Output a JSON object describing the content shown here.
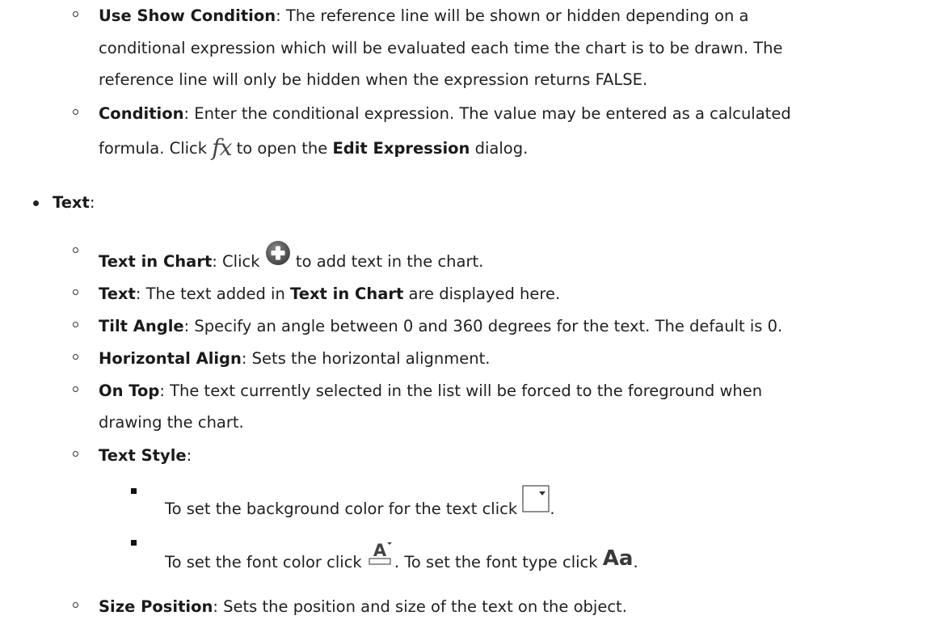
{
  "items": {
    "show_condition": {
      "term": "Use Show Condition",
      "l1": ": The reference line will be shown or hidden depending on a",
      "l2": "conditional expression which will be evaluated each time the chart is to be drawn. The",
      "l3": "reference line will only be hidden when the expression returns FALSE."
    },
    "condition": {
      "term": "Condition",
      "l1": ": Enter the conditional expression. The value may be entered as a calculated",
      "l2a": "formula. Click ",
      "fx": "fx",
      "l2b": " to open the ",
      "edit_expr": "Edit Expression",
      "l2c": " dialog."
    },
    "text_heading": {
      "term": "Text",
      "tail": ":"
    },
    "text_in_chart": {
      "term": "Text in Chart",
      "a": ": Click ",
      "b": " to add text in the chart."
    },
    "text": {
      "term": "Text",
      "a": ": The text added in ",
      "ref": "Text in Chart",
      "b": " are displayed here."
    },
    "tilt_angle": {
      "term": "Tilt Angle",
      "a": ": Specify an angle between 0 and 360 degrees for the text. The default is 0."
    },
    "horizontal_align": {
      "term": "Horizontal Align",
      "a": ": Sets the horizontal alignment."
    },
    "on_top": {
      "term": "On Top",
      "a": ": The text currently selected in the list will be forced to the foreground when",
      "b": "drawing the chart."
    },
    "text_style": {
      "term": "Text Style",
      "tail": ":",
      "bg": {
        "a": "To set the background color for the text click ",
        "b": "."
      },
      "font": {
        "a": "To set the font color click ",
        "b": ". To set the font type click ",
        "aa": "Aa",
        "c": "."
      }
    },
    "size_position": {
      "term": "Size Position",
      "a": ": Sets the position and size of the text on the object."
    }
  },
  "icons": {
    "fx": "fx-icon",
    "add": "plus-circle-icon",
    "background": "dropdown-color-icon",
    "font_color": "font-color-icon",
    "font_type": "font-type-icon"
  },
  "colors": {
    "text": "#1f1f1f",
    "icon": "#555555"
  }
}
